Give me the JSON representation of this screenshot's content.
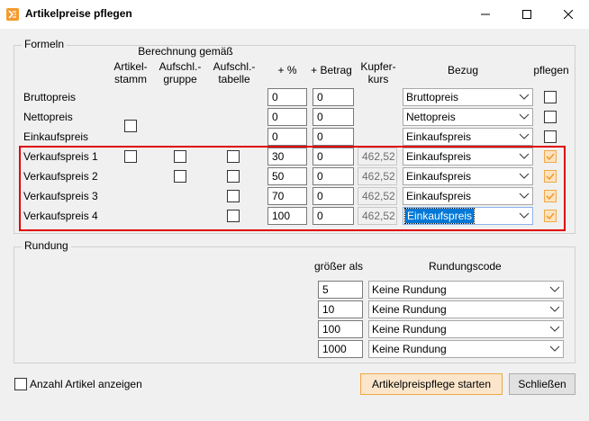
{
  "window": {
    "title": "Artikelpreise pflegen"
  },
  "formeln": {
    "legend": "Formeln",
    "header_group": "Berechnung gemäß",
    "headers": {
      "artikelstamm": [
        "Artikel-",
        "stamm"
      ],
      "aufschlag_gruppe": [
        "Aufschl.-",
        "gruppe"
      ],
      "aufschlag_tabelle": [
        "Aufschl.-",
        "tabelle"
      ],
      "prozent": "+ %",
      "betrag": "+ Betrag",
      "kupferkurs": [
        "Kupfer-",
        "kurs"
      ],
      "bezug": "Bezug",
      "pflegen": "pflegen"
    },
    "rows": [
      {
        "label": "Bruttopreis",
        "prozent": "0",
        "betrag": "0",
        "bezug": "Bruttopreis",
        "pflegen": false
      },
      {
        "label": "Nettopreis",
        "artikelstamm": false,
        "prozent": "0",
        "betrag": "0",
        "bezug": "Nettopreis",
        "pflegen": false
      },
      {
        "label": "Einkaufspreis",
        "prozent": "0",
        "betrag": "0",
        "bezug": "Einkaufspreis",
        "pflegen": false
      },
      {
        "label": "Verkaufspreis 1",
        "artikelstamm": false,
        "aufschlag_gruppe": false,
        "aufschlag_tabelle": false,
        "prozent": "30",
        "betrag": "0",
        "kupferkurs": "462,52",
        "bezug": "Einkaufspreis",
        "pflegen": true
      },
      {
        "label": "Verkaufspreis 2",
        "aufschlag_gruppe": false,
        "aufschlag_tabelle": false,
        "prozent": "50",
        "betrag": "0",
        "kupferkurs": "462,52",
        "bezug": "Einkaufspreis",
        "pflegen": true
      },
      {
        "label": "Verkaufspreis 3",
        "aufschlag_tabelle": false,
        "prozent": "70",
        "betrag": "0",
        "kupferkurs": "462,52",
        "bezug": "Einkaufspreis",
        "pflegen": true
      },
      {
        "label": "Verkaufspreis 4",
        "aufschlag_tabelle": false,
        "prozent": "100",
        "betrag": "0",
        "kupferkurs": "462,52",
        "bezug": "Einkaufspreis",
        "pflegen": true
      }
    ]
  },
  "rundung": {
    "legend": "Rundung",
    "header_groesser": "größer als",
    "header_code": "Rundungscode",
    "rows": [
      {
        "groesser_als": "5",
        "code": "Keine Rundung"
      },
      {
        "groesser_als": "10",
        "code": "Keine Rundung"
      },
      {
        "groesser_als": "100",
        "code": "Keine Rundung"
      },
      {
        "groesser_als": "1000",
        "code": "Keine Rundung"
      }
    ]
  },
  "footer": {
    "anzahl_label": "Anzahl Artikel anzeigen",
    "anzahl_checked": false,
    "start_button": "Artikelpreispflege starten",
    "close_button": "Schließen"
  },
  "colors": {
    "accent": "#f59a2c",
    "highlight_border": "#e00000",
    "selection": "#0078d7",
    "checked_fill": "#fce3bf"
  }
}
